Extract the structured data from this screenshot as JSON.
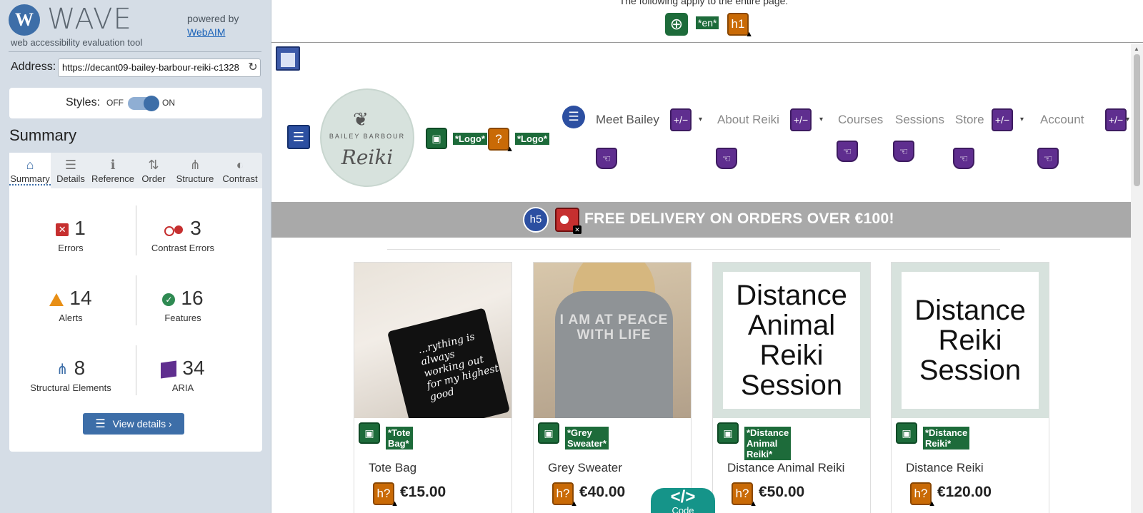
{
  "wave": {
    "brand_logo": "W",
    "brand_name": "WAVE",
    "brand_sub": "web accessibility evaluation tool",
    "powered_by": "powered by",
    "webaim": "WebAIM",
    "address_label": "Address:",
    "address_value": "https://decant09-bailey-barbour-reiki-c1328",
    "styles_label": "Styles:",
    "styles_off": "OFF",
    "styles_on": "ON",
    "summary_heading": "Summary",
    "tabs": [
      {
        "label": "Summary",
        "icon": "home-icon",
        "glyph": "⌂"
      },
      {
        "label": "Details",
        "icon": "list-icon",
        "glyph": "☰"
      },
      {
        "label": "Reference",
        "icon": "info-icon",
        "glyph": "ℹ"
      },
      {
        "label": "Order",
        "icon": "order-icon",
        "glyph": "⇅"
      },
      {
        "label": "Structure",
        "icon": "structure-icon",
        "glyph": "⋔"
      },
      {
        "label": "Contrast",
        "icon": "contrast-icon",
        "glyph": "◐"
      }
    ],
    "stats": {
      "errors": {
        "value": "1",
        "label": "Errors"
      },
      "contrast": {
        "value": "3",
        "label": "Contrast Errors"
      },
      "alerts": {
        "value": "14",
        "label": "Alerts"
      },
      "features": {
        "value": "16",
        "label": "Features"
      },
      "structural": {
        "value": "8",
        "label": "Structural Elements"
      },
      "aria": {
        "value": "34",
        "label": "ARIA"
      }
    },
    "view_details": "View details ›",
    "colors": {
      "accent": "#3d6ea8",
      "error": "#c62f2f",
      "alert": "#e88f16",
      "feature": "#2f8a52",
      "aria": "#5f2e8f"
    }
  },
  "page": {
    "topbar_note": "The following apply to the entire page:",
    "lang_badge": "*en*",
    "h1_badge": "h1",
    "logo": {
      "name": "BAILEY BARBOUR",
      "script": "Reiki"
    },
    "logo_alt_1": "*Logo*",
    "logo_alt_2": "*Logo*",
    "unknown_badge": "?",
    "nav": {
      "items": [
        "Meet Bailey",
        "About Reiki",
        "Courses",
        "Sessions",
        "Store",
        "Account"
      ],
      "toggle_badge": "+/−",
      "caret": "▾"
    },
    "banner": {
      "h5": "h5",
      "text": "FREE DELIVERY ON ORDERS OVER €100!"
    },
    "products": [
      {
        "alt": "*Tote Bag*",
        "name": "Tote Bag",
        "price": "€15.00",
        "badge": "h?",
        "photo_text": "...rything is always working out for my highest good"
      },
      {
        "alt": "*Grey Sweater*",
        "name": "Grey Sweater",
        "price": "€40.00",
        "badge": "h?",
        "photo_text": "I AM AT PEACE WITH LIFE"
      },
      {
        "alt": "*Distance Animal Reiki*",
        "name": "Distance Animal Reiki",
        "price": "€50.00",
        "badge": "h?",
        "tile_text": "Distance Animal Reiki Session"
      },
      {
        "alt": "*Distance Reiki*",
        "name": "Distance Reiki",
        "price": "€120.00",
        "badge": "h?",
        "tile_text": "Distance Reiki Session"
      }
    ],
    "code_tab": {
      "icon": "</>",
      "label": "Code"
    }
  }
}
